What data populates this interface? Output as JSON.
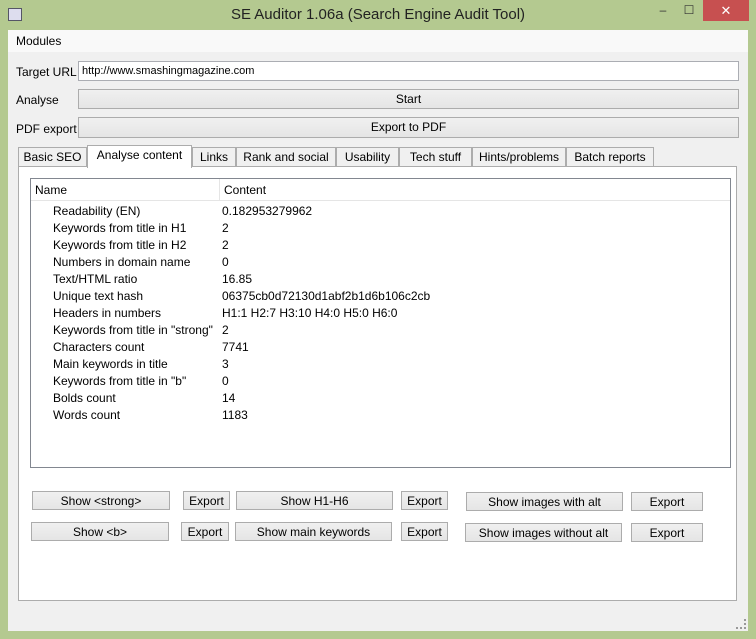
{
  "window": {
    "title": "SE Auditor 1.06a (Search Engine Audit Tool)",
    "minimize": "–",
    "maximize": "☐",
    "close": "✕"
  },
  "menu": {
    "modules": "Modules"
  },
  "form": {
    "target_url_label": "Target URL",
    "target_url_value": "http://www.smashingmagazine.com",
    "analyse_label": "Analyse",
    "start_button": "Start",
    "pdf_label": "PDF export",
    "pdf_button": "Export to PDF"
  },
  "tabs": [
    "Basic SEO",
    "Analyse content",
    "Links",
    "Rank and social",
    "Usability",
    "Tech stuff",
    "Hints/problems",
    "Batch reports"
  ],
  "tree": {
    "headers": [
      "Name",
      "Content"
    ],
    "rows": [
      {
        "name": "Readability (EN)",
        "value": "0.182953279962"
      },
      {
        "name": "Keywords from title in H1",
        "value": "2"
      },
      {
        "name": "Keywords from title in H2",
        "value": "2"
      },
      {
        "name": "Numbers in domain name",
        "value": "0"
      },
      {
        "name": "Text/HTML ratio",
        "value": "16.85"
      },
      {
        "name": "Unique text hash",
        "value": "06375cb0d72130d1abf2b1d6b106c2cb"
      },
      {
        "name": "Headers in numbers",
        "value": "H1:1 H2:7 H3:10 H4:0 H5:0 H6:0"
      },
      {
        "name": "Keywords from title in \"strong\"",
        "value": "2"
      },
      {
        "name": "Characters count",
        "value": "7741"
      },
      {
        "name": "Main keywords in title",
        "value": "3"
      },
      {
        "name": "Keywords from title in \"b\"",
        "value": "0"
      },
      {
        "name": "Bolds count",
        "value": "14"
      },
      {
        "name": "Words count",
        "value": "1183"
      }
    ]
  },
  "buttons": {
    "show_strong": "Show <strong>",
    "show_h": "Show H1-H6",
    "show_img_alt": "Show images with alt",
    "show_b": "Show <b>",
    "show_main_kw": "Show main keywords",
    "show_img_noalt": "Show images without alt",
    "export": "Export"
  }
}
